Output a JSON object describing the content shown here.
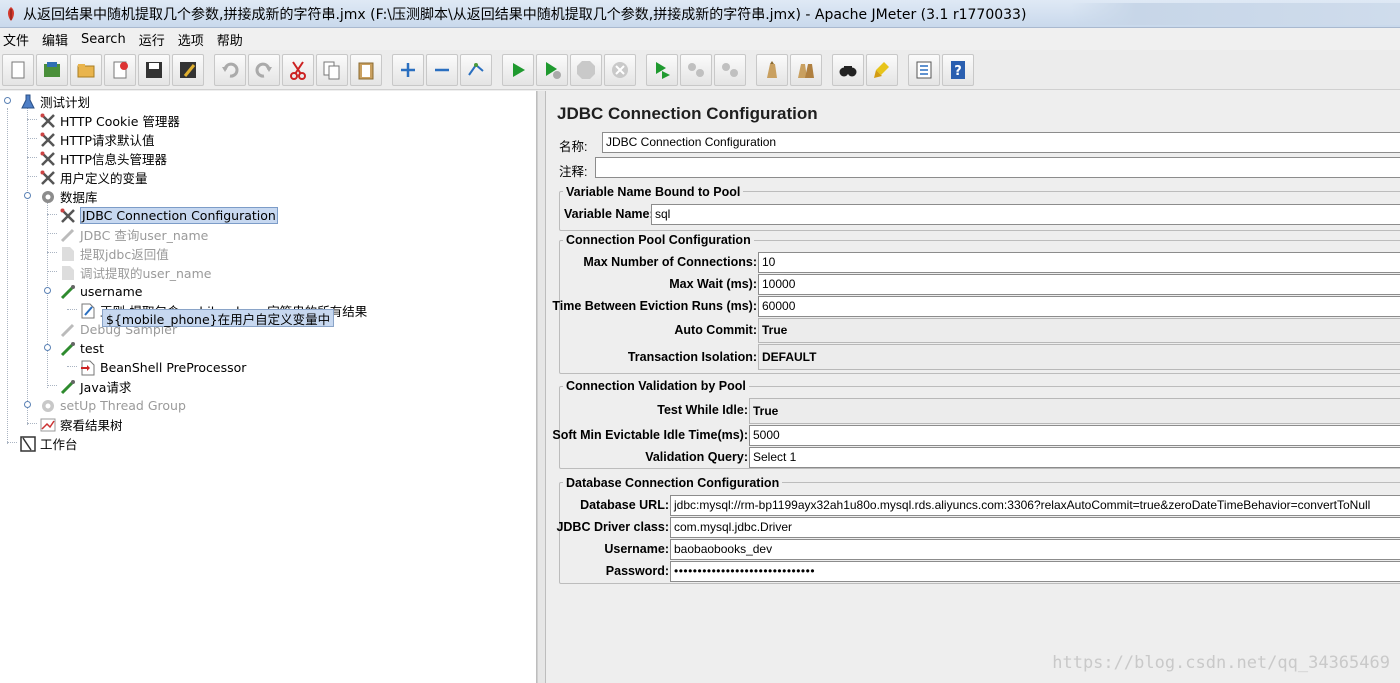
{
  "window": {
    "title": "从返回结果中随机提取几个参数,拼接成新的字符串.jmx (F:\\压测脚本\\从返回结果中随机提取几个参数,拼接成新的字符串.jmx) - Apache JMeter (3.1 r1770033)"
  },
  "menu": [
    "文件",
    "编辑",
    "Search",
    "运行",
    "选项",
    "帮助"
  ],
  "toolbar": {
    "buttons": [
      {
        "icon": "new-icon"
      },
      {
        "icon": "templates-icon"
      },
      {
        "icon": "open-icon"
      },
      {
        "icon": "close-file-icon"
      },
      {
        "icon": "save-icon"
      },
      {
        "icon": "save-as-icon"
      },
      {
        "icon": "undo-icon"
      },
      {
        "icon": "redo-icon"
      },
      {
        "icon": "cut-icon"
      },
      {
        "icon": "copy-icon"
      },
      {
        "icon": "paste-icon"
      },
      {
        "icon": "expand-icon"
      },
      {
        "icon": "collapse-icon"
      },
      {
        "icon": "toggle-icon"
      },
      {
        "icon": "start-icon"
      },
      {
        "icon": "start-no-pause-icon"
      },
      {
        "icon": "stop-icon"
      },
      {
        "icon": "shutdown-icon"
      },
      {
        "icon": "remote-start-icon"
      },
      {
        "icon": "remote-stop-icon"
      },
      {
        "icon": "remote-shutdown-icon"
      },
      {
        "icon": "clear-icon"
      },
      {
        "icon": "clear-all-icon"
      },
      {
        "icon": "search-icon"
      },
      {
        "icon": "reset-search-icon"
      },
      {
        "icon": "function-helper-icon"
      },
      {
        "icon": "help-icon"
      }
    ]
  },
  "tree": {
    "items": [
      {
        "label": "测试计划"
      },
      {
        "label": "HTTP Cookie 管理器"
      },
      {
        "label": "HTTP请求默认值"
      },
      {
        "label": "HTTP信息头管理器"
      },
      {
        "label": "用户定义的变量"
      },
      {
        "label": "数据库"
      },
      {
        "label": "JDBC Connection Configuration"
      },
      {
        "label": "JDBC 查询user_name"
      },
      {
        "label": "提取jdbc返回值"
      },
      {
        "label": "调试提取的user_name"
      },
      {
        "label": "username"
      },
      {
        "label": "正则-提取包含mobile_phone字符串的所有结果"
      },
      {
        "label": "Debug Sampler"
      },
      {
        "label": "test"
      },
      {
        "label": "BeanShell PreProcessor"
      },
      {
        "label": "Java请求"
      },
      {
        "label": "setUp Thread Group"
      },
      {
        "label": "察看结果树"
      },
      {
        "label": "工作台"
      }
    ],
    "tooltip": "${mobile_phone}在用户自定义变量中"
  },
  "config": {
    "title": "JDBC Connection Configuration",
    "name_label": "名称:",
    "name_value": "JDBC Connection Configuration",
    "comment_label": "注释:",
    "comment_value": "",
    "var_group": {
      "title": "Variable Name Bound to Pool",
      "var_label": "Variable Name:",
      "var_value": "sql"
    },
    "pool_group": {
      "title": "Connection Pool Configuration",
      "max_conn_label": "Max Number of Connections:",
      "max_conn_value": "10",
      "max_wait_label": "Max Wait (ms):",
      "max_wait_value": "10000",
      "eviction_label": "Time Between Eviction Runs (ms):",
      "eviction_value": "60000",
      "autocommit_label": "Auto Commit:",
      "autocommit_value": "True",
      "isolation_label": "Transaction Isolation:",
      "isolation_value": "DEFAULT"
    },
    "validation_group": {
      "title": "Connection Validation by Pool",
      "test_idle_label": "Test While Idle:",
      "test_idle_value": "True",
      "soft_min_label": "Soft Min Evictable Idle Time(ms):",
      "soft_min_value": "5000",
      "query_label": "Validation Query:",
      "query_value": "Select 1"
    },
    "db_group": {
      "title": "Database Connection Configuration",
      "url_label": "Database URL:",
      "url_value": "jdbc:mysql://rm-bp1199ayx32ah1u80o.mysql.rds.aliyuncs.com:3306?relaxAutoCommit=true&zeroDateTimeBehavior=convertToNull",
      "driver_label": "JDBC Driver class:",
      "driver_value": "com.mysql.jdbc.Driver",
      "user_label": "Username:",
      "user_value": "baobaobooks_dev",
      "pass_label": "Password:",
      "pass_value": "••••••••••••••••••••••••••••••"
    }
  },
  "watermark": "https://blog.csdn.net/qq_34365469"
}
